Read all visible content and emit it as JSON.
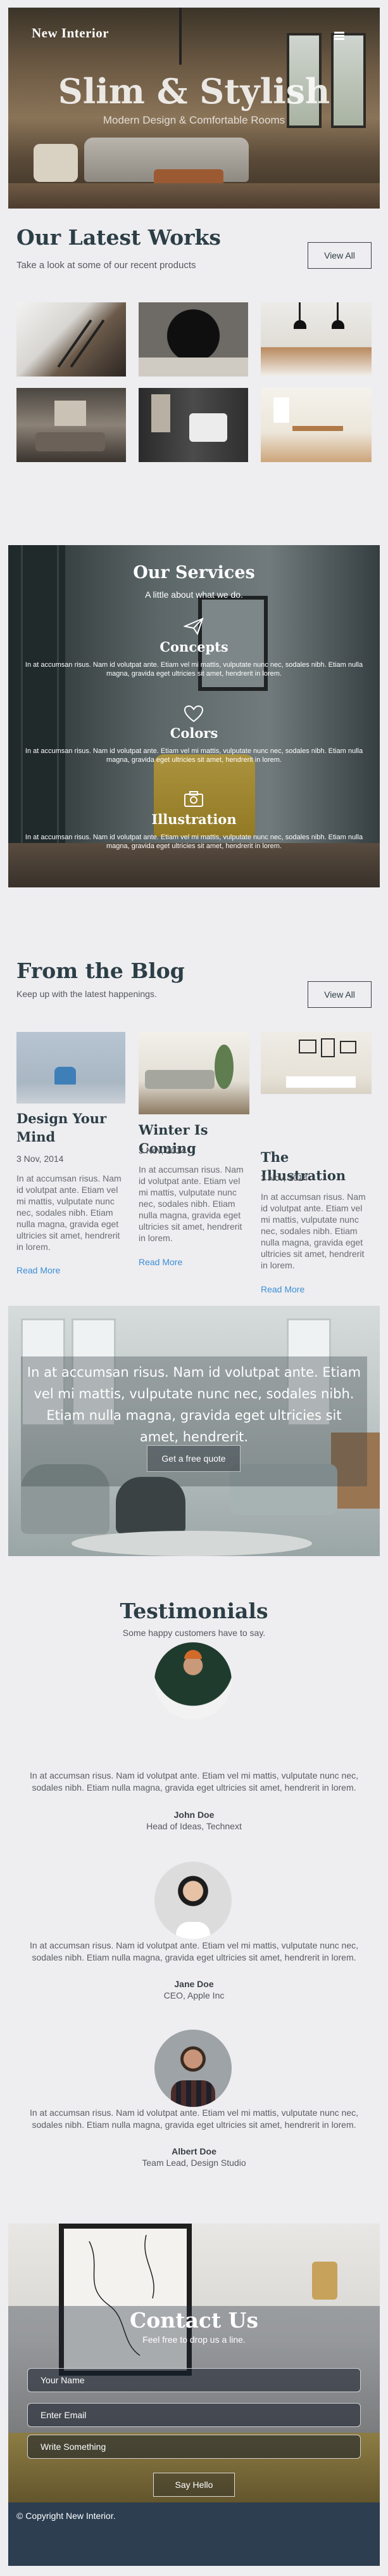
{
  "header": {
    "brand": "New Interior",
    "menu_icon": "hamburger-menu-icon"
  },
  "hero": {
    "title": "Slim & Stylish",
    "subtitle": "Modern Design & Comfortable Rooms"
  },
  "works": {
    "title": "Our Latest Works",
    "subtitle": "Take a look at some of our recent products",
    "button_label": "View All"
  },
  "services": {
    "title": "Our Services",
    "subtitle": "A little about what we do.",
    "items": [
      {
        "icon": "paper-plane-icon",
        "title": "Concepts",
        "text": "In at accumsan risus. Nam id volutpat ante. Etiam vel mi mattis, vulputate nunc nec, sodales nibh. Etiam nulla magna, gravida eget ultricies sit amet, hendrerit in lorem."
      },
      {
        "icon": "heart-icon",
        "title": "Colors",
        "text": "In at accumsan risus. Nam id volutpat ante. Etiam vel mi mattis, vulputate nunc nec, sodales nibh. Etiam nulla magna, gravida eget ultricies sit amet, hendrerit in lorem."
      },
      {
        "icon": "camera-icon",
        "title": "Illustration",
        "text": "In at accumsan risus. Nam id volutpat ante. Etiam vel mi mattis, vulputate nunc nec, sodales nibh. Etiam nulla magna, gravida eget ultricies sit amet, hendrerit in lorem."
      }
    ]
  },
  "blog": {
    "title": "From the Blog",
    "subtitle": "Keep up with the latest happenings.",
    "button_label": "View All",
    "posts": [
      {
        "title": "Design Your Mind",
        "date": "3 Nov, 2014",
        "text": "In at accumsan risus. Nam id volutpat ante. Etiam vel mi mattis, vulputate nunc nec, sodales nibh. Etiam nulla magna, gravida eget ultricies sit amet, hendrerit in lorem.",
        "link": "Read More"
      },
      {
        "title": "Winter Is Coming",
        "date": "3 Nov, 2014",
        "text": "In at accumsan risus. Nam id volutpat ante. Etiam vel mi mattis, vulputate nunc nec, sodales nibh. Etiam nulla magna, gravida eget ultricies sit amet, hendrerit in lorem.",
        "link": "Read More"
      },
      {
        "title": "The Illustration",
        "date": "3 Nov, 2014",
        "text": "In at accumsan risus. Nam id volutpat ante. Etiam vel mi mattis, vulputate nunc nec, sodales nibh. Etiam nulla magna, gravida eget ultricies sit amet, hendrerit in lorem.",
        "link": "Read More"
      }
    ]
  },
  "cta": {
    "text": "In at accumsan risus. Nam id volutpat ante. Etiam vel mi mattis, vulputate nunc nec, sodales nibh. Etiam nulla magna, gravida eget ultricies sit amet, hendrerit.",
    "button_label": "Get a free quote"
  },
  "testimonials": {
    "title": "Testimonials",
    "subtitle": "Some happy customers have to say.",
    "items": [
      {
        "quote": "In at accumsan risus. Nam id volutpat ante. Etiam vel mi mattis, vulputate nunc nec, sodales nibh. Etiam nulla magna, gravida eget ultricies sit amet, hendrerit in lorem.",
        "name": "John Doe",
        "role": "Head of Ideas, Technext"
      },
      {
        "quote": "In at accumsan risus. Nam id volutpat ante. Etiam vel mi mattis, vulputate nunc nec, sodales nibh. Etiam nulla magna, gravida eget ultricies sit amet, hendrerit in lorem.",
        "name": "Jane Doe",
        "role": "CEO, Apple Inc"
      },
      {
        "quote": "In at accumsan risus. Nam id volutpat ante. Etiam vel mi mattis, vulputate nunc nec, sodales nibh. Etiam nulla magna, gravida eget ultricies sit amet, hendrerit in lorem.",
        "name": "Albert Doe",
        "role": "Team Lead, Design Studio"
      }
    ]
  },
  "contact": {
    "title": "Contact Us",
    "subtitle": "Feel free to drop us a line.",
    "name_placeholder": "Your Name",
    "email_placeholder": "Enter Email",
    "message_placeholder": "Write Something",
    "button_label": "Say Hello"
  },
  "footer": {
    "copyright": "© Copyright New Interior."
  },
  "colors": {
    "page_bg": "#eeedf0",
    "heading": "#2c3e46",
    "link": "#3a8fd6",
    "footer_bg": "#2c3e50"
  }
}
